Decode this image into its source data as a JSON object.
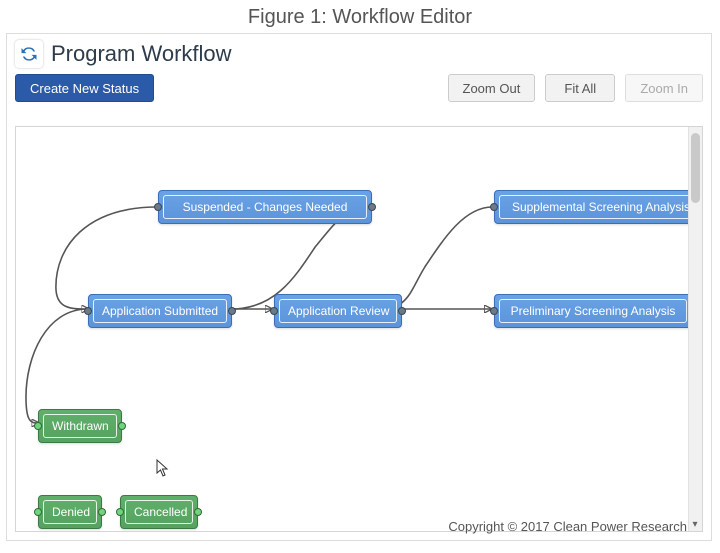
{
  "figure_caption": "Figure 1: Workflow Editor",
  "header": {
    "title": "Program Workflow"
  },
  "toolbar": {
    "create_label": "Create New Status",
    "zoom_out_label": "Zoom Out",
    "fit_all_label": "Fit All",
    "zoom_in_label": "Zoom In"
  },
  "nodes": {
    "suspended": {
      "label": "Suspended - Changes Needed",
      "kind": "blue"
    },
    "supplemental": {
      "label": "Supplemental Screening Analysis",
      "kind": "blue"
    },
    "submitted": {
      "label": "Application Submitted",
      "kind": "blue"
    },
    "review": {
      "label": "Application Review",
      "kind": "blue"
    },
    "preliminary": {
      "label": "Preliminary Screening Analysis",
      "kind": "blue"
    },
    "withdrawn": {
      "label": "Withdrawn",
      "kind": "green"
    },
    "denied": {
      "label": "Denied",
      "kind": "green"
    },
    "cancelled": {
      "label": "Cancelled",
      "kind": "green"
    }
  },
  "footer": {
    "copyright": "Copyright © 2017 Clean Power Research"
  }
}
